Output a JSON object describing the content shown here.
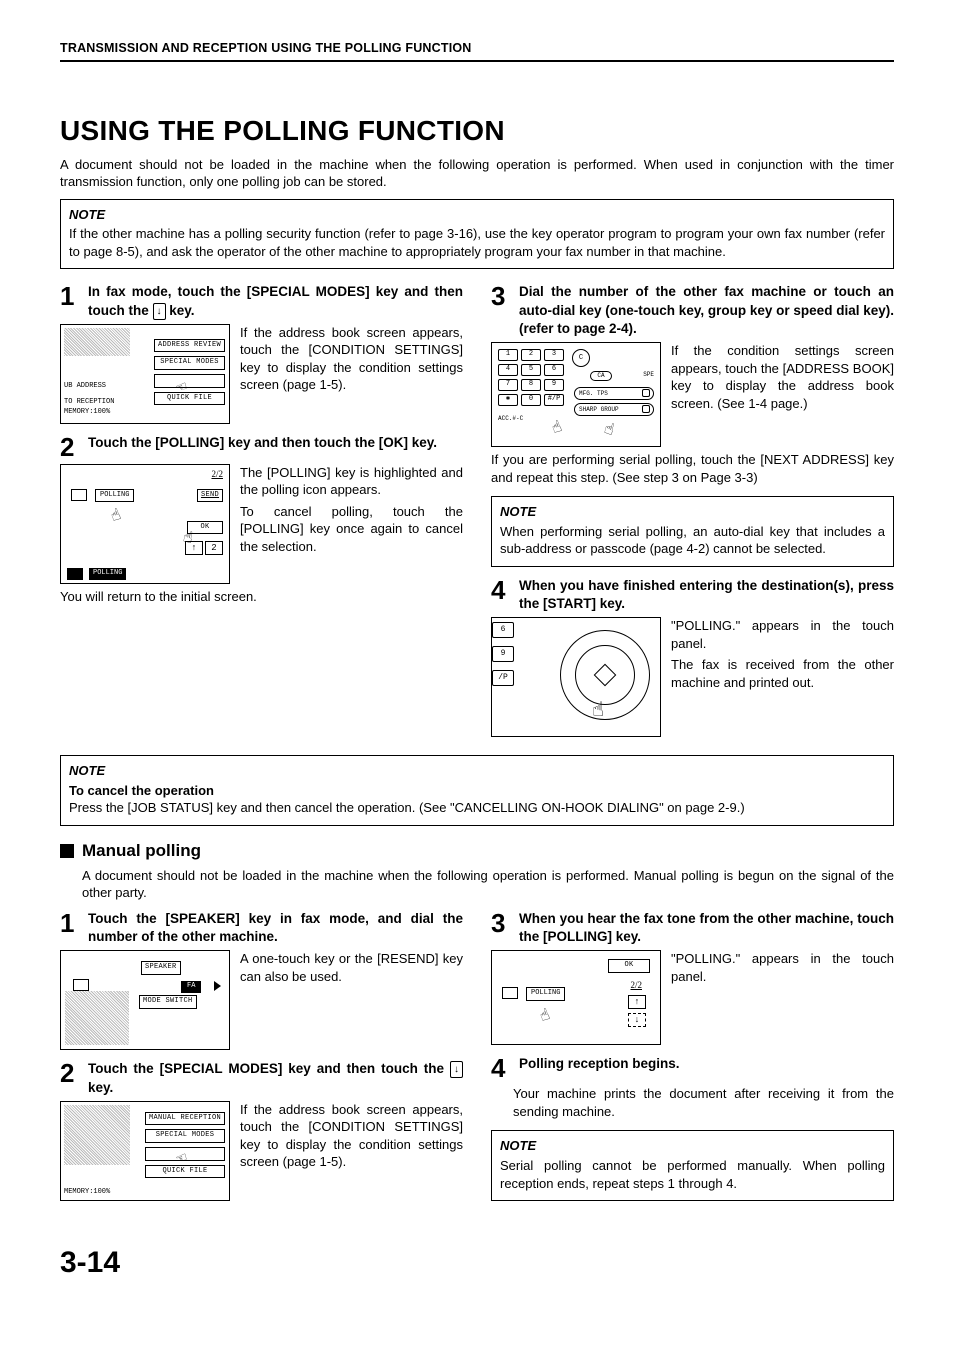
{
  "header": "TRANSMISSION AND RECEPTION USING THE POLLING FUNCTION",
  "title": "USING THE POLLING FUNCTION",
  "intro": "A document should not be loaded in the machine when the following operation is performed. When used in conjunction with the timer transmission function, only one polling job can be stored.",
  "topNote": {
    "title": "NOTE",
    "text": "If the other machine has a polling security function (refer to page 3-16), use the key operator program to program your own fax number (refer to page 8-5), and ask the operator of the other machine to appropriately program your fax number in that machine."
  },
  "steps": {
    "s1": {
      "num": "1",
      "title_a": "In fax mode, touch the [SPECIAL MODES] key and then touch the ",
      "title_b": " key.",
      "text": "If the address book screen appears, touch the [CONDITION SETTINGS] key to display the condition settings screen (page 1-5).",
      "illus": {
        "btn1": "ADDRESS REVIEW",
        "btn2": "SPECIAL MODES",
        "btn3": "QUICK FILE",
        "l1": "UB ADDRESS",
        "l2": "TO RECEPTION",
        "l3": "MEMORY:100%"
      }
    },
    "s2": {
      "num": "2",
      "title": "Touch the [POLLING] key and then touch the [OK] key.",
      "text": "The [POLLING] key is highlighted and the polling icon appears.",
      "text2": "To cancel polling, touch the [POLLING] key once again to cancel the selection.",
      "trail": "You will return to the initial screen.",
      "illus": {
        "page": "2/2",
        "poll": "POLLING",
        "send": "SEND",
        "ok": "OK",
        "badge": "2",
        "bar": "POLLING"
      }
    },
    "s3": {
      "num": "3",
      "title": "Dial the number of the other fax machine or touch an auto-dial key (one-touch key,  group key or speed dial key). (refer to page 2-4).",
      "text": "If the condition settings screen appears, touch the [ADDRESS BOOK] key to display the address book screen. (See 1-4 page.)",
      "text2": "If you are performing serial polling, touch the [NEXT ADDRESS] key and repeat this step. (See step 3 on Page 3-3)",
      "illus": {
        "k1": "1",
        "k2": "2",
        "k3": "3",
        "k4": "4",
        "k5": "5",
        "k6": "6",
        "k7": "7",
        "k8": "8",
        "k9": "9",
        "ks": "✱",
        "k0": "0",
        "kh": "#/P",
        "ca": "CA",
        "c": "C",
        "spe": "SPE",
        "e1": "MFG. TPS",
        "e2": "SHARP GROUP",
        "acc": "ACC.#-C"
      }
    },
    "s3note": {
      "title": "NOTE",
      "text": "When performing serial polling, an auto-dial key that includes a sub-address or passcode (page 4-2) cannot be selected."
    },
    "s4": {
      "num": "4",
      "title": "When you have finished entering the destination(s), press the [START] key.",
      "text": "\"POLLING.\" appears in the touch panel.",
      "text2": "The fax is received from the other machine and printed out.",
      "illus": {
        "k6": "6",
        "k9": "9",
        "kh": "/P"
      }
    }
  },
  "cancelNote": {
    "title": "NOTE",
    "sub": "To cancel the operation",
    "text": "Press the [JOB STATUS] key and then cancel the operation. (See \"CANCELLING ON-HOOK DIALING\" on page 2-9.)"
  },
  "manual": {
    "heading": "Manual polling",
    "intro": "A document should not be loaded in the machine when the following operation is performed. Manual polling is begun on the signal of the other party.",
    "s1": {
      "num": "1",
      "title": "Touch the [SPEAKER] key in fax mode, and dial the number of the other machine.",
      "text": "A one-touch key or the [RESEND] key can also be used.",
      "illus": {
        "spk": "SPEAKER",
        "fa": "FA",
        "ms": "MODE SWITCH"
      }
    },
    "s2": {
      "num": "2",
      "title_a": "Touch the [SPECIAL MODES] key and then touch the ",
      "title_b": " key.",
      "text": "If the address book screen appears, touch the [CONDITION SETTINGS] key to display the condition settings screen (page 1-5).",
      "illus": {
        "btn1": "MANUAL RECEPTION",
        "btn2": "SPECIAL MODES",
        "btn3": "QUICK FILE",
        "mem": "MEMORY:100%"
      }
    },
    "s3": {
      "num": "3",
      "title": "When you hear the fax tone from the other machine, touch the [POLLING] key.",
      "text": "\"POLLING.\" appears in the touch panel.",
      "illus": {
        "ok": "OK",
        "page": "2/2",
        "poll": "POLLING"
      }
    },
    "s4": {
      "num": "4",
      "title": "Polling reception begins.",
      "text": "Your machine prints the document after receiving it from the sending machine."
    },
    "note": {
      "title": "NOTE",
      "text": "Serial polling cannot be performed manually. When polling reception ends, repeat steps 1 through 4."
    }
  },
  "pageNum": "3-14"
}
